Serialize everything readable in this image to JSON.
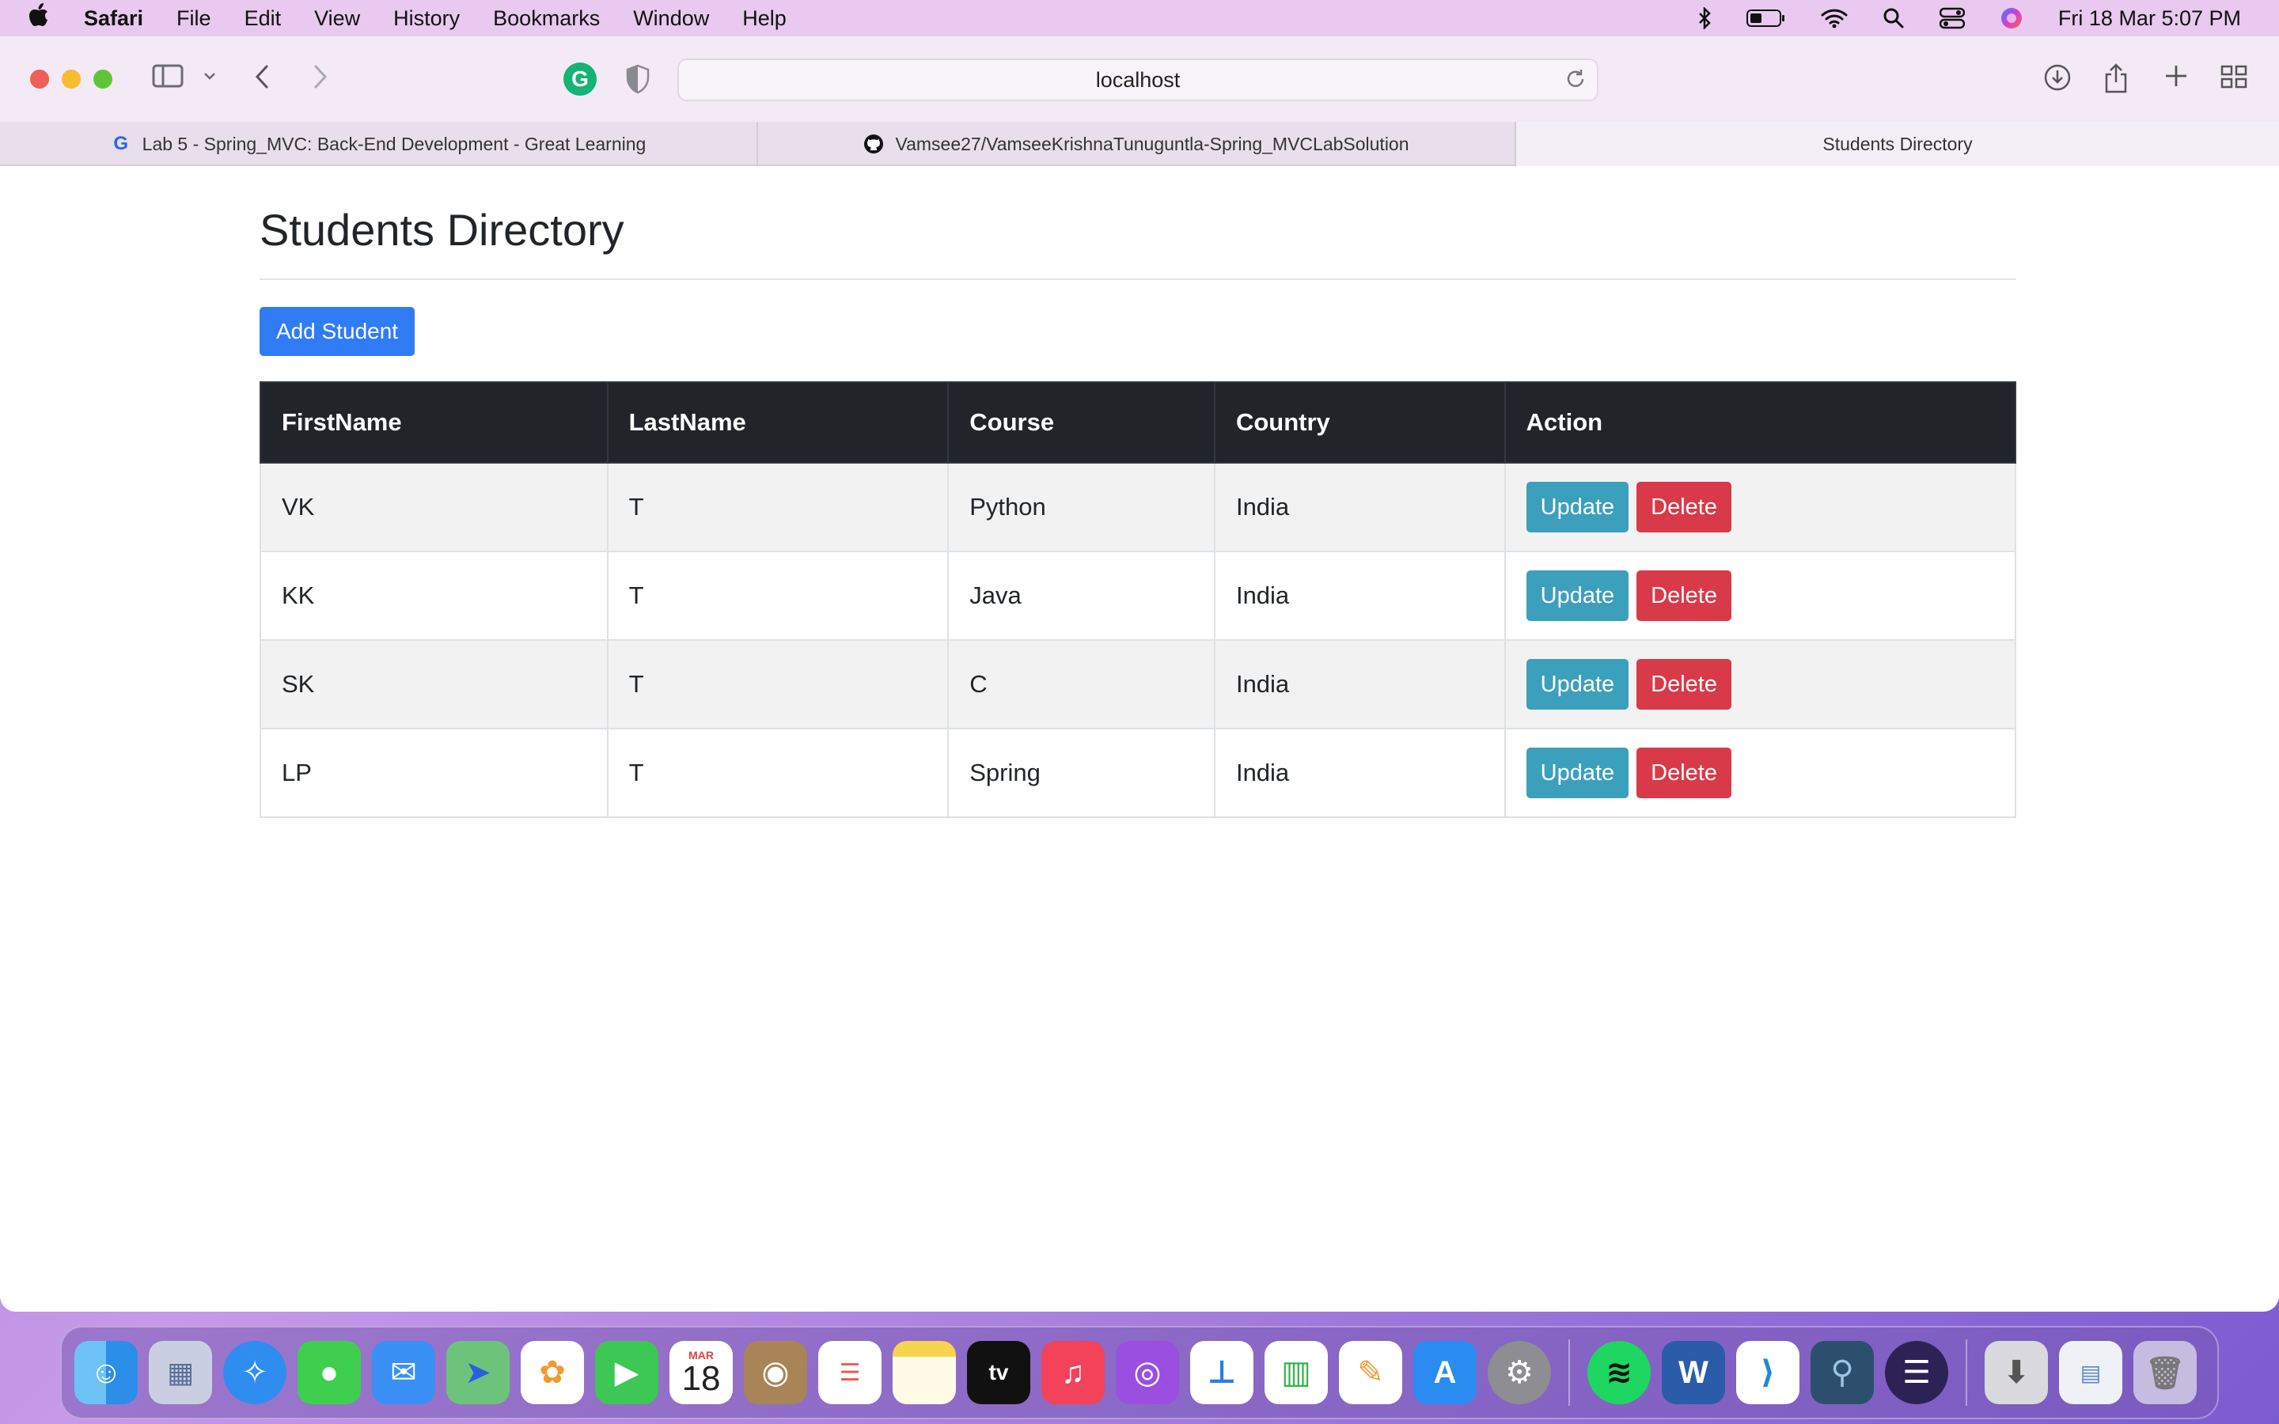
{
  "menubar": {
    "app": "Safari",
    "menus": [
      "File",
      "Edit",
      "View",
      "History",
      "Bookmarks",
      "Window",
      "Help"
    ],
    "clock": "Fri 18 Mar  5:07 PM"
  },
  "browser": {
    "address": "localhost",
    "tabs": [
      {
        "label": "Lab 5 - Spring_MVC: Back-End Development - Great Learning",
        "icon": "google-icon"
      },
      {
        "label": "Vamsee27/VamseeKrishnaTunuguntla-Spring_MVCLabSolution",
        "icon": "github-icon"
      },
      {
        "label": "Students Directory",
        "icon": "",
        "active": true
      }
    ]
  },
  "page": {
    "title": "Students Directory",
    "add_button": "Add Student",
    "table": {
      "headers": [
        "FirstName",
        "LastName",
        "Course",
        "Country",
        "Action"
      ],
      "rows": [
        {
          "first": "VK",
          "last": "T",
          "course": "Python",
          "country": "India"
        },
        {
          "first": "KK",
          "last": "T",
          "course": "Java",
          "country": "India"
        },
        {
          "first": "SK",
          "last": "T",
          "course": "C",
          "country": "India"
        },
        {
          "first": "LP",
          "last": "T",
          "course": "Spring",
          "country": "India"
        }
      ],
      "update_label": "Update",
      "delete_label": "Delete"
    }
  },
  "colors": {
    "primary": "#2f7cf6",
    "info": "#3ca0bc",
    "danger": "#d83a49",
    "table_header": "#212529"
  },
  "dock": {
    "calendar_month": "MAR",
    "calendar_day": "18",
    "apps": [
      "finder-icon",
      "launchpad-icon",
      "safari-icon",
      "messages-icon",
      "mail-icon",
      "maps-icon",
      "photos-icon",
      "facetime-icon",
      "calendar-icon",
      "contacts-icon",
      "reminders-icon",
      "notes-icon",
      "tv-icon",
      "music-icon",
      "podcasts-icon",
      "keynote-icon",
      "numbers-icon",
      "pages-icon",
      "app-store-icon",
      "system-preferences-icon",
      "spotify-icon",
      "word-icon",
      "vscode-icon",
      "mysql-workbench-icon",
      "eclipse-icon",
      "downloads-icon",
      "documents-icon",
      "trash-icon"
    ]
  }
}
